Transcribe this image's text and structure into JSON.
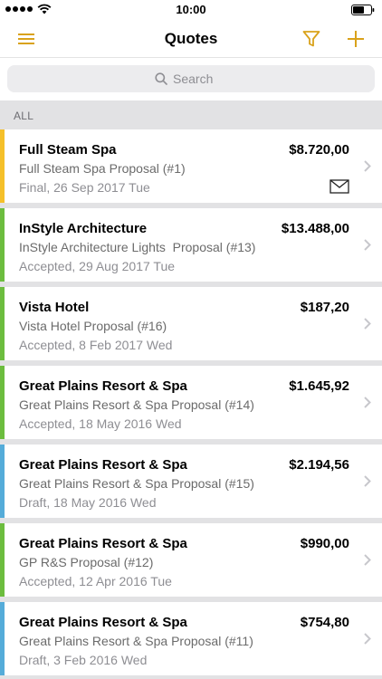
{
  "status_bar": {
    "time": "10:00"
  },
  "nav": {
    "title": "Quotes",
    "menu_icon": "hamburger-menu-icon",
    "filter_icon": "filter-icon",
    "add_icon": "plus-icon"
  },
  "search": {
    "placeholder": "Search",
    "icon": "search-icon"
  },
  "section": {
    "label": "ALL"
  },
  "colors": {
    "accent": "#d9a21b",
    "final": "#f5c02a",
    "accepted": "#6cbd3e",
    "draft": "#55acd9"
  },
  "quotes": [
    {
      "client": "Full Steam Spa",
      "amount": "$8.720,00",
      "proposal": "Full Steam Spa Proposal (#1)",
      "status": "Final, 26 Sep 2017 Tue",
      "state": "final",
      "has_mail_icon": true
    },
    {
      "client": "InStyle Architecture",
      "amount": "$13.488,00",
      "proposal": "InStyle Architecture Lights  Proposal (#13)",
      "status": "Accepted, 29 Aug 2017 Tue",
      "state": "accepted",
      "has_mail_icon": false
    },
    {
      "client": "Vista Hotel",
      "amount": "$187,20",
      "proposal": "Vista Hotel Proposal (#16)",
      "status": "Accepted, 8 Feb 2017 Wed",
      "state": "accepted",
      "has_mail_icon": false
    },
    {
      "client": "Great Plains Resort & Spa",
      "amount": "$1.645,92",
      "proposal": "Great Plains Resort & Spa Proposal (#14)",
      "status": "Accepted, 18 May 2016 Wed",
      "state": "accepted",
      "has_mail_icon": false
    },
    {
      "client": "Great Plains Resort & Spa",
      "amount": "$2.194,56",
      "proposal": "Great Plains Resort & Spa Proposal (#15)",
      "status": "Draft, 18 May 2016 Wed",
      "state": "draft",
      "has_mail_icon": false
    },
    {
      "client": "Great Plains Resort & Spa",
      "amount": "$990,00",
      "proposal": "GP R&S Proposal (#12)",
      "status": "Accepted, 12 Apr 2016 Tue",
      "state": "accepted",
      "has_mail_icon": false
    },
    {
      "client": "Great Plains Resort & Spa",
      "amount": "$754,80",
      "proposal": "Great Plains Resort & Spa Proposal (#11)",
      "status": "Draft, 3 Feb 2016 Wed",
      "state": "draft",
      "has_mail_icon": false
    }
  ]
}
